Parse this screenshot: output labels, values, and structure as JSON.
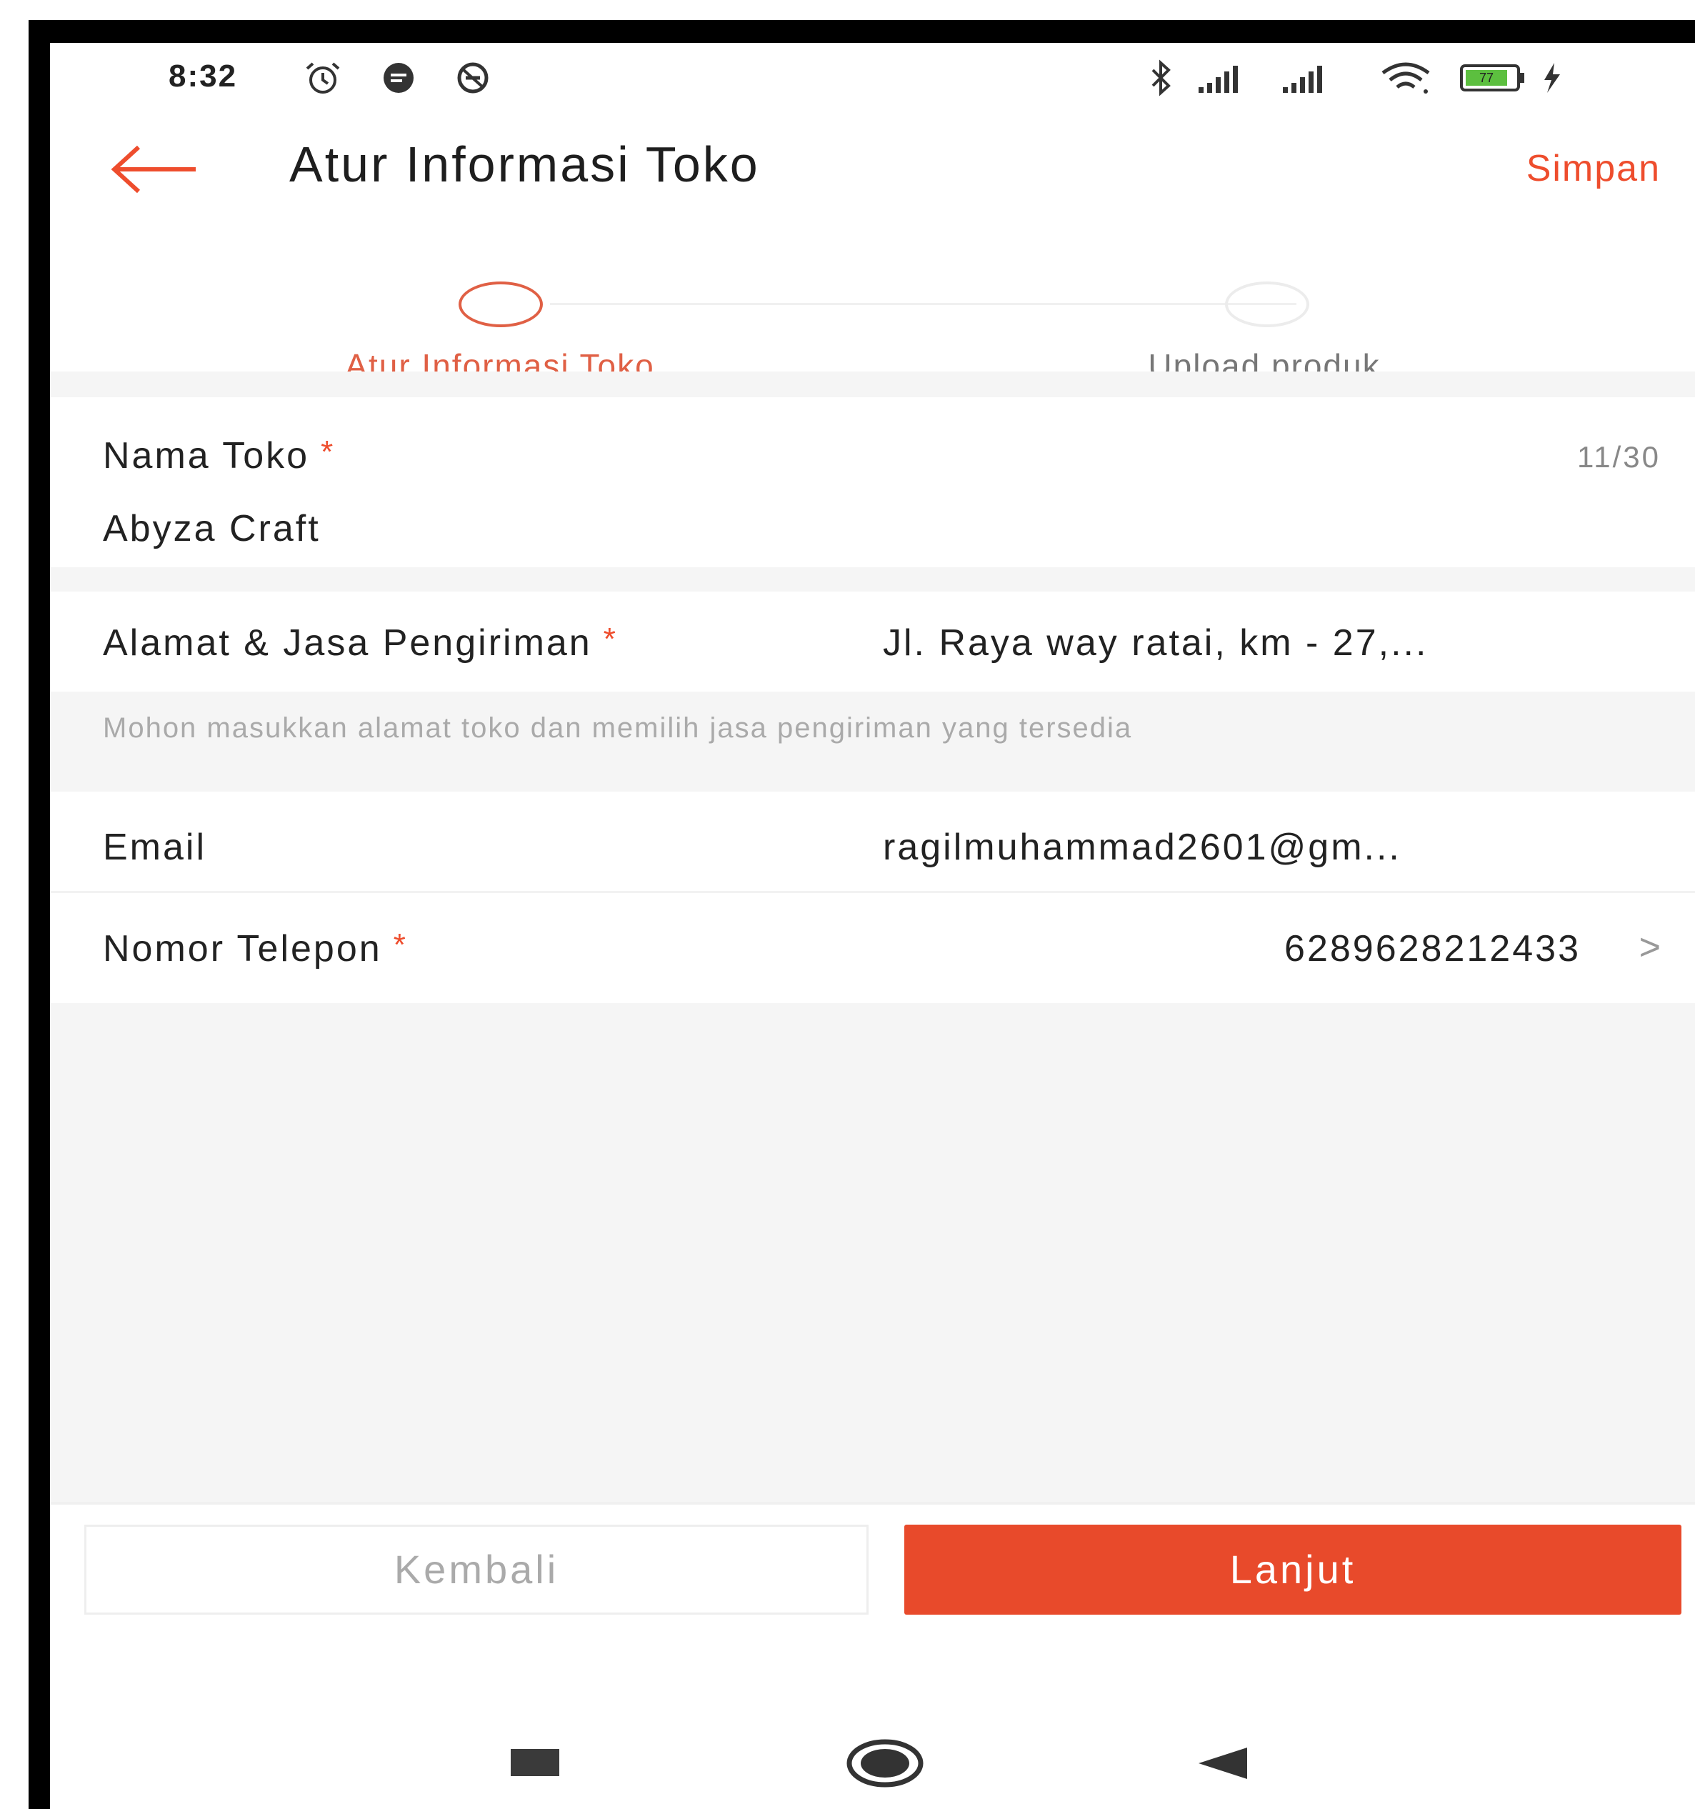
{
  "status_bar": {
    "time": "8:32",
    "left_icons": [
      "alarm-icon",
      "message-icon",
      "vpn-icon"
    ],
    "right_icons": [
      "bluetooth-icon",
      "signal-icon",
      "signal-icon",
      "wifi-icon",
      "battery-icon",
      "charging-icon"
    ],
    "battery_level": "77"
  },
  "header": {
    "back_icon": "arrow-left-icon",
    "title": "Atur Informasi Toko",
    "save_label": "Simpan"
  },
  "stepper": {
    "steps": [
      {
        "label": "Atur Informasi Toko",
        "active": true
      },
      {
        "label": "Upload produk",
        "active": false
      }
    ]
  },
  "form": {
    "store_name": {
      "label": "Nama Toko",
      "required": "*",
      "counter": "11/30",
      "value": "Abyza Craft"
    },
    "address": {
      "label": "Alamat & Jasa Pengiriman",
      "required": "*",
      "value": "Jl. Raya way ratai, km - 27,...",
      "hint": "Mohon masukkan alamat toko dan memilih jasa pengiriman yang tersedia"
    },
    "email": {
      "label": "Email",
      "value": "ragilmuhammad2601@gm..."
    },
    "phone": {
      "label": "Nomor Telepon",
      "required": "*",
      "value": "6289628212433",
      "chevron": ">"
    }
  },
  "footer": {
    "back_label": "Kembali",
    "next_label": "Lanjut"
  },
  "nav": {
    "icons": [
      "recent-apps-icon",
      "home-icon",
      "back-icon"
    ]
  },
  "colors": {
    "accent": "#ee4d2d",
    "button": "#e84a2b",
    "background": "#f5f5f5"
  }
}
